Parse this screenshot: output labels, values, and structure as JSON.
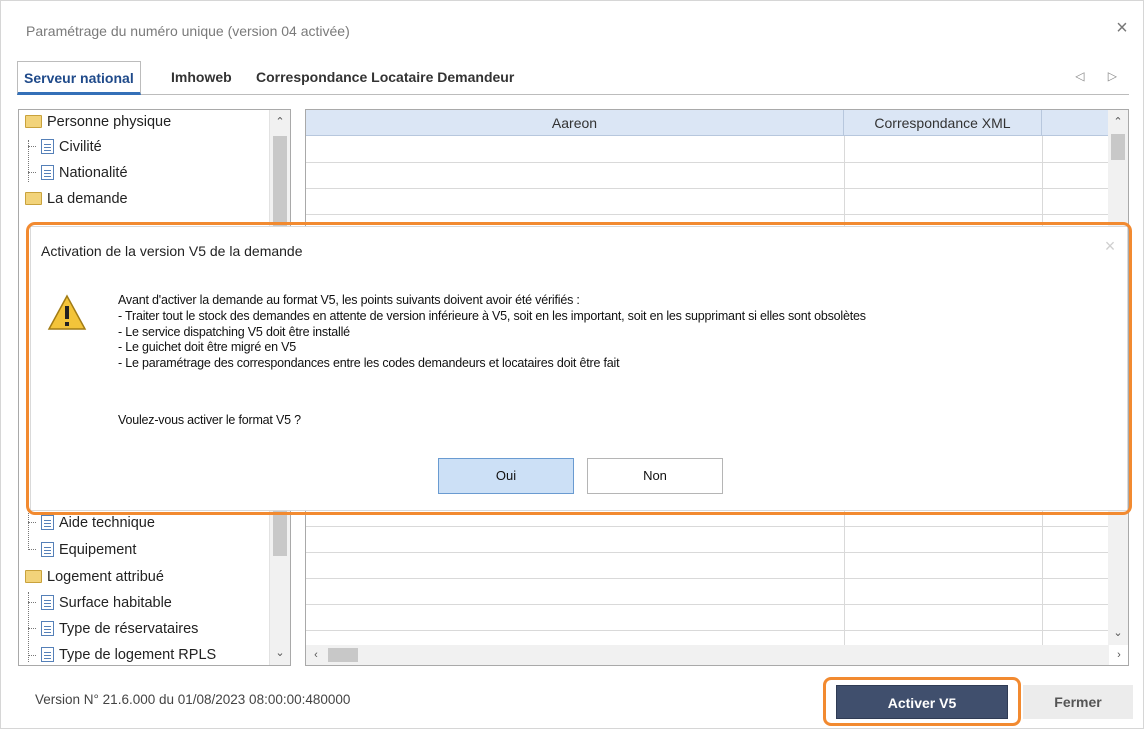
{
  "window": {
    "title": "Paramétrage du numéro unique (version 04 activée)",
    "close_glyph": "×"
  },
  "tabs": {
    "items": [
      "Serveur national",
      "Imhoweb",
      "Correspondance Locataire Demandeur"
    ],
    "arrows": "◁ ▷"
  },
  "tree": {
    "items": [
      {
        "label": "Personne physique",
        "icon": "folder-icon"
      },
      {
        "label": "Civilité",
        "icon": "document-icon"
      },
      {
        "label": "Nationalité",
        "icon": "document-icon"
      },
      {
        "label": "La demande",
        "icon": "folder-icon"
      },
      {
        "label": "Aide technique",
        "icon": "document-icon"
      },
      {
        "label": "Equipement",
        "icon": "document-icon"
      },
      {
        "label": "Logement attribué",
        "icon": "folder-icon"
      },
      {
        "label": "Surface habitable",
        "icon": "document-icon"
      },
      {
        "label": "Type de réservataires",
        "icon": "document-icon"
      },
      {
        "label": "Type de logement RPLS",
        "icon": "document-icon"
      }
    ]
  },
  "grid": {
    "columns": [
      "Aareon",
      "Correspondance XML",
      ""
    ]
  },
  "dialog": {
    "title": "Activation de la version V5 de la demande",
    "close_glyph": "×",
    "icon": "warning-icon",
    "message_lines": [
      "Avant d'activer la demande au format V5, les points suivants doivent avoir été vérifiés :",
      "- Traiter tout le stock des demandes en attente de version inférieure à V5, soit en les important, soit en les supprimant si elles sont obsolètes",
      "- Le service dispatching V5 doit être installé",
      "- Le guichet doit être migré en V5",
      "- Le paramétrage des correspondances entre les codes demandeurs et locataires doit être fait"
    ],
    "question": "Voulez-vous activer le format V5 ?",
    "yes_label": "Oui",
    "no_label": "Non"
  },
  "status": {
    "version": "Version N° 21.6.000 du 01/08/2023 08:00:00:480000"
  },
  "footer": {
    "activate_label": "Activer V5",
    "close_label": "Fermer"
  },
  "colors": {
    "highlight": "#f28a30",
    "activate_button": "#404f6d",
    "grid_header": "#dbe6f5",
    "active_tab": "#1f4a8a"
  }
}
